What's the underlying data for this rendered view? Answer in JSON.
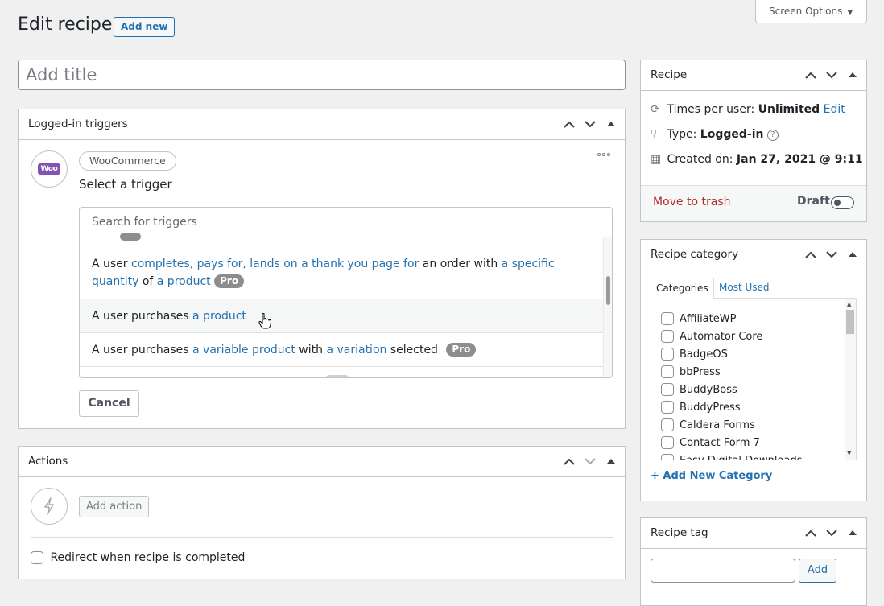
{
  "header": {
    "title": "Edit recipe",
    "add_new_label": "Add new",
    "screen_options_label": "Screen Options"
  },
  "title_input": {
    "placeholder": "Add title",
    "value": ""
  },
  "triggers_box": {
    "title": "Logged-in triggers",
    "integration_label": "WooCommerce",
    "logo_text": "Woo",
    "select_trigger_label": "Select a trigger",
    "search_placeholder": "Search for triggers",
    "options": [
      {
        "parts": [
          {
            "text": "A user ",
            "link": false
          },
          {
            "text": "completes, pays for, lands on a thank you page for",
            "link": true
          },
          {
            "text": " an order with ",
            "link": false
          },
          {
            "text": "a specific quantity",
            "link": true
          },
          {
            "text": " of ",
            "link": false
          },
          {
            "text": "a product",
            "link": true
          }
        ],
        "pro": true
      },
      {
        "parts": [
          {
            "text": "A user purchases ",
            "link": false
          },
          {
            "text": "a product",
            "link": true
          }
        ],
        "pro": false,
        "hovered": true
      },
      {
        "parts": [
          {
            "text": "A user purchases ",
            "link": false
          },
          {
            "text": "a variable product",
            "link": true
          },
          {
            "text": " with ",
            "link": false
          },
          {
            "text": "a variation",
            "link": true
          },
          {
            "text": " selected",
            "link": false
          }
        ],
        "pro": true
      }
    ],
    "pro_label": "Pro",
    "cancel_label": "Cancel"
  },
  "actions_box": {
    "title": "Actions",
    "add_action_label": "Add action",
    "redirect_label": "Redirect when recipe is completed"
  },
  "recipe_box": {
    "title": "Recipe",
    "times_label": "Times per user:",
    "times_value": "Unlimited",
    "edit_label": "Edit",
    "type_label": "Type:",
    "type_value": "Logged-in",
    "created_label": "Created on:",
    "created_value": "Jan 27, 2021 @ 9:11",
    "trash_label": "Move to trash",
    "status_label": "Draft"
  },
  "category_box": {
    "title": "Recipe category",
    "tabs": [
      "Categories",
      "Most Used"
    ],
    "items": [
      "AffiliateWP",
      "Automator Core",
      "BadgeOS",
      "bbPress",
      "BuddyBoss",
      "BuddyPress",
      "Caldera Forms",
      "Contact Form 7",
      "Easy Digital Downloads"
    ],
    "add_new_label": "+ Add New Category"
  },
  "tag_box": {
    "title": "Recipe tag",
    "add_label": "Add"
  },
  "colors": {
    "link": "#2271b1",
    "trash": "#b32d2e",
    "woo_purple": "#7f54b3",
    "pro_badge": "#8d8d8d"
  }
}
